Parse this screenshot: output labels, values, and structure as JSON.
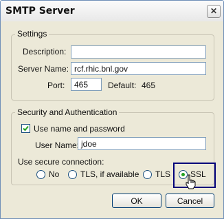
{
  "window": {
    "title": "SMTP Server",
    "close_glyph": "✕"
  },
  "settings": {
    "legend": "Settings",
    "description": {
      "label": "Description:",
      "value": ""
    },
    "server_name": {
      "label": "Server Name:",
      "value": "rcf.rhic.bnl.gov"
    },
    "port": {
      "label": "Port:",
      "value": "465",
      "default_label": "Default:",
      "default_value": "465"
    }
  },
  "security": {
    "legend": "Security and Authentication",
    "use_name_password": {
      "label": "Use name and password",
      "checked": true
    },
    "user_name": {
      "label": "User Name:",
      "value": "jdoe"
    },
    "secure_connection_label": "Use secure connection:",
    "options": [
      {
        "label": "No",
        "selected": false
      },
      {
        "label": "TLS, if available",
        "selected": false
      },
      {
        "label": "TLS",
        "selected": false
      },
      {
        "label": "SSL",
        "selected": true
      }
    ]
  },
  "buttons": {
    "ok": "OK",
    "cancel": "Cancel"
  },
  "colors": {
    "highlight_border": "#00007a",
    "radio_dot": "#21a121"
  }
}
